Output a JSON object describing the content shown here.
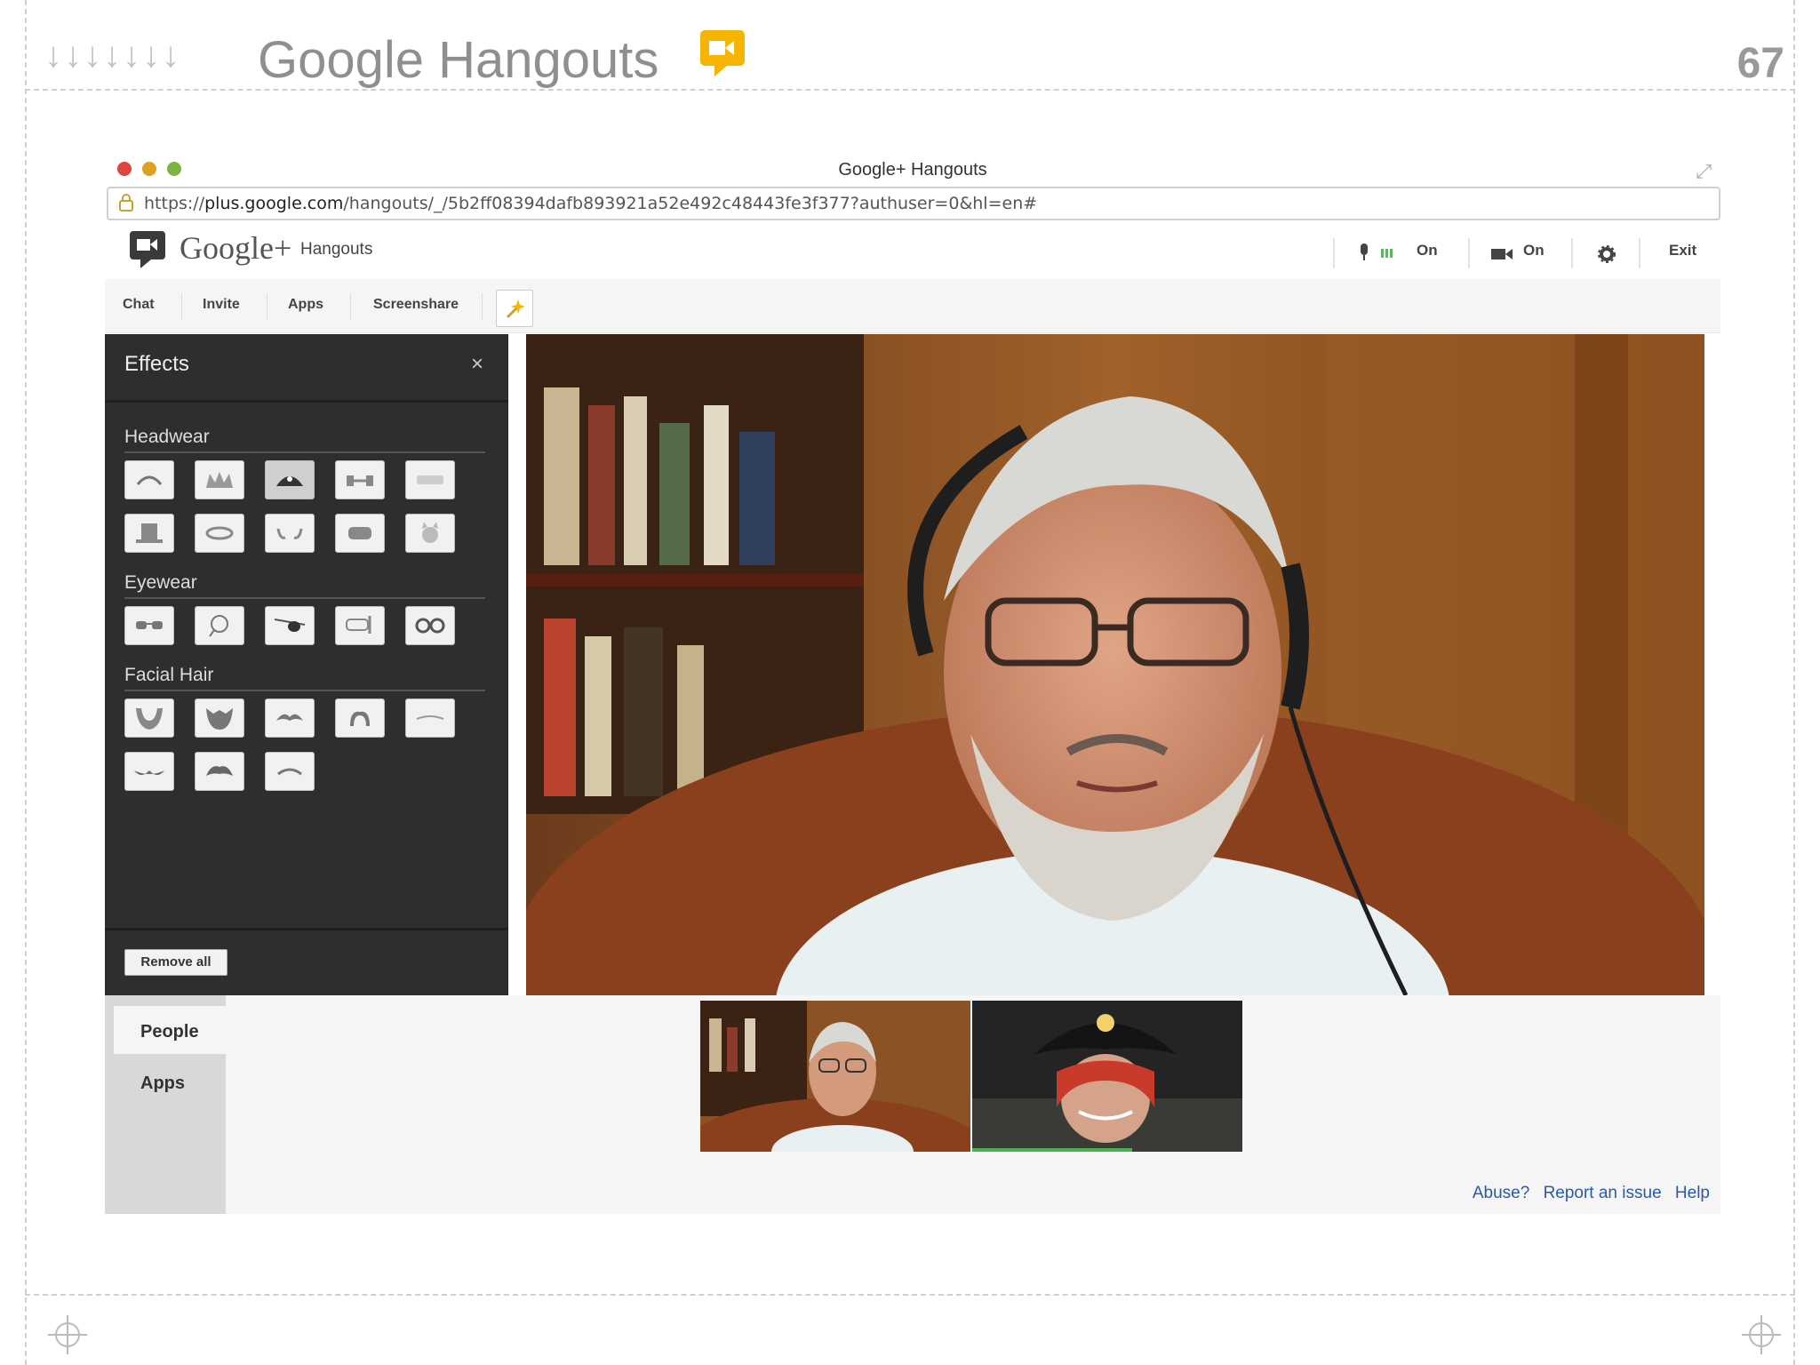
{
  "slide": {
    "arrows": "↓↓↓↓↓↓↓",
    "title": "Google Hangouts",
    "number": "67",
    "accent": "#f4b400"
  },
  "window": {
    "title": "Google+ Hangouts",
    "url_prefix": "https://",
    "url_host": "plus.google.com",
    "url_path": "/hangouts/_/5b2ff08394dafb893921a52e492c48443fe3f377?authuser=0&hl=en#"
  },
  "app_header": {
    "brand": "Google+",
    "product": "Hangouts",
    "mic_state": "On",
    "cam_state": "On",
    "exit_label": "Exit"
  },
  "toolbar": {
    "chat": "Chat",
    "invite": "Invite",
    "apps": "Apps",
    "screenshare": "Screenshare"
  },
  "effects_panel": {
    "title": "Effects",
    "close": "×",
    "sections": [
      {
        "label": "Headwear"
      },
      {
        "label": "Eyewear"
      },
      {
        "label": "Facial Hair"
      }
    ],
    "remove_all": "Remove all"
  },
  "sidebar": {
    "tabs": [
      "People",
      "Apps"
    ]
  },
  "footer_links": {
    "abuse": "Abuse?",
    "report": "Report an issue",
    "help": "Help"
  }
}
